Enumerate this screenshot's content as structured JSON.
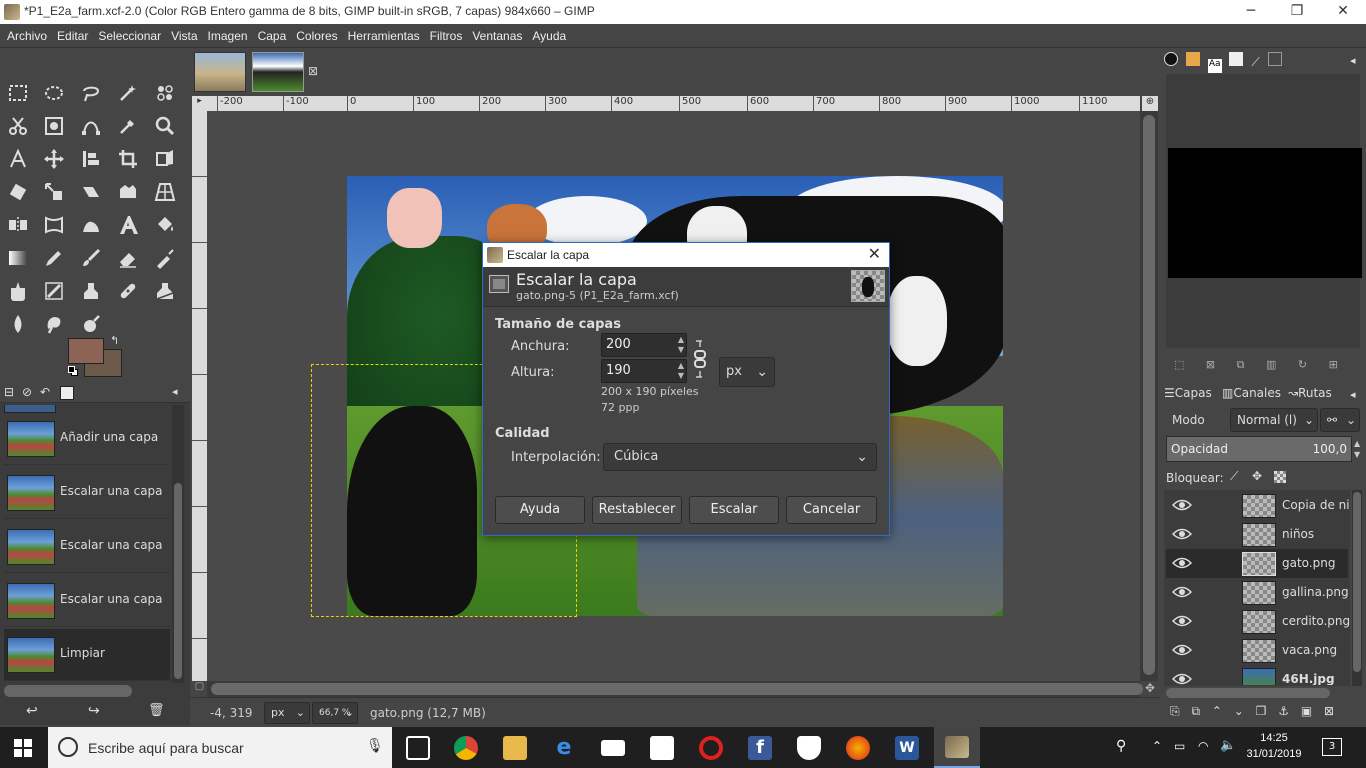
{
  "window": {
    "title": "*P1_E2a_farm.xcf-2.0 (Color RGB Entero gamma de 8 bits, GIMP built-in sRGB, 7 capas) 984x660 – GIMP"
  },
  "menubar": {
    "items": [
      "Archivo",
      "Editar",
      "Seleccionar",
      "Vista",
      "Imagen",
      "Capa",
      "Colores",
      "Herramientas",
      "Filtros",
      "Ventanas",
      "Ayuda"
    ]
  },
  "ruler": {
    "ticks": [
      "-200",
      "-100",
      "0",
      "100",
      "200",
      "300",
      "400",
      "500",
      "600",
      "700",
      "800",
      "900",
      "1000",
      "1100"
    ]
  },
  "history": {
    "items": [
      "Añadir una capa",
      "Escalar una capa",
      "Escalar una capa",
      "Escalar una capa",
      "Limpiar"
    ]
  },
  "status": {
    "coords": "-4, 319",
    "unit": "px",
    "zoom": "66,7 %",
    "info": "gato.png (12,7 MB)"
  },
  "layers_panel": {
    "tabs": [
      "Capas",
      "Canales",
      "Rutas"
    ],
    "mode_label": "Modo",
    "mode_value": "Normal (l)",
    "opacity_label": "Opacidad",
    "opacity_value": "100,0",
    "lock_label": "Bloquear:",
    "layers": [
      "Copia de ni",
      "niños",
      "gato.png",
      "gallina.png",
      "cerdito.png",
      "vaca.png",
      "46H.jpg"
    ]
  },
  "dialog": {
    "window_title": "Escalar la capa",
    "heading": "Escalar la capa",
    "subheading": "gato.png-5 (P1_E2a_farm.xcf)",
    "size_section": "Tamaño de capas",
    "width_label": "Anchura:",
    "width_value": "200",
    "height_label": "Altura:",
    "height_value": "190",
    "unit_value": "px",
    "size_info": "200 x 190 píxeles",
    "resolution_info": "72 ppp",
    "quality_section": "Calidad",
    "interp_label": "Interpolación:",
    "interp_value": "Cúbica",
    "buttons": {
      "help": "Ayuda",
      "reset": "Restablecer",
      "scale": "Escalar",
      "cancel": "Cancelar"
    }
  },
  "taskbar": {
    "search_placeholder": "Escribe aquí para buscar",
    "time": "14:25",
    "date": "31/01/2019",
    "notifications": "3"
  }
}
